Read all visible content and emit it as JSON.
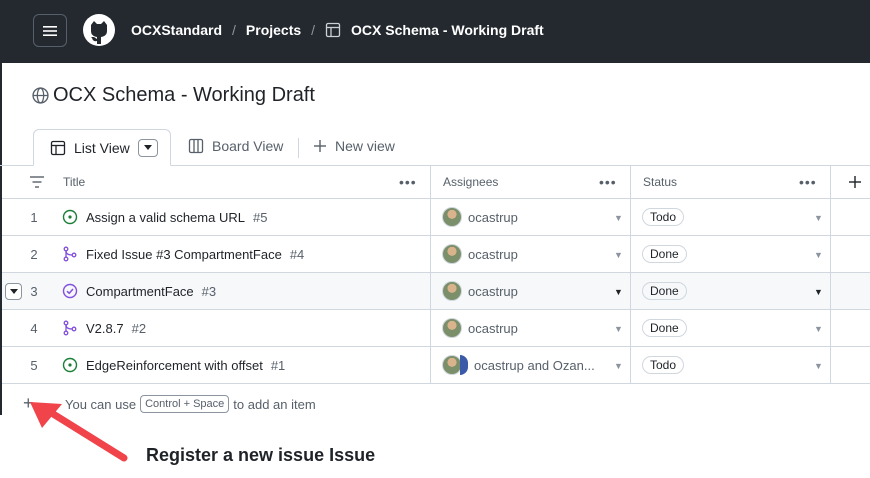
{
  "topbar": {
    "breadcrumbs": [
      {
        "label": "OCXStandard"
      },
      {
        "label": "Projects"
      },
      {
        "label": "OCX Schema - Working Draft"
      }
    ]
  },
  "page": {
    "title": "OCX Schema - Working Draft"
  },
  "views": {
    "tabs": [
      {
        "label": "List View",
        "active": true
      },
      {
        "label": "Board View",
        "active": false
      }
    ],
    "new_view_label": "New view"
  },
  "table": {
    "columns": [
      "Title",
      "Assignees",
      "Status"
    ],
    "rows": [
      {
        "num": "1",
        "title": "Assign a valid schema URL",
        "issue": "#5",
        "icon": "issue-open-icon",
        "assignee": "ocastrup",
        "status": "Todo"
      },
      {
        "num": "2",
        "title": "Fixed Issue #3 CompartmentFace",
        "issue": "#4",
        "icon": "pull-request-merged-icon",
        "assignee": "ocastrup",
        "status": "Done"
      },
      {
        "num": "3",
        "title": "CompartmentFace",
        "issue": "#3",
        "icon": "issue-closed-icon",
        "assignee": "ocastrup",
        "status": "Done"
      },
      {
        "num": "4",
        "title": "V2.8.7",
        "issue": "#2",
        "icon": "pull-request-merged-icon",
        "assignee": "ocastrup",
        "status": "Done"
      },
      {
        "num": "5",
        "title": "EdgeReinforcement with offset",
        "issue": "#1",
        "icon": "issue-open-icon",
        "assignee": "ocastrup and Ozan...",
        "status": "Todo"
      }
    ]
  },
  "add_item": {
    "prefix": "You can use",
    "shortcut": "Control + Space",
    "suffix": "to add an item"
  },
  "annotation": {
    "text": "Register a new issue Issue"
  },
  "colors": {
    "topbar": "#24292f",
    "open": "#1a7f37",
    "merged": "#8250df",
    "arrow": "#f0444a"
  }
}
